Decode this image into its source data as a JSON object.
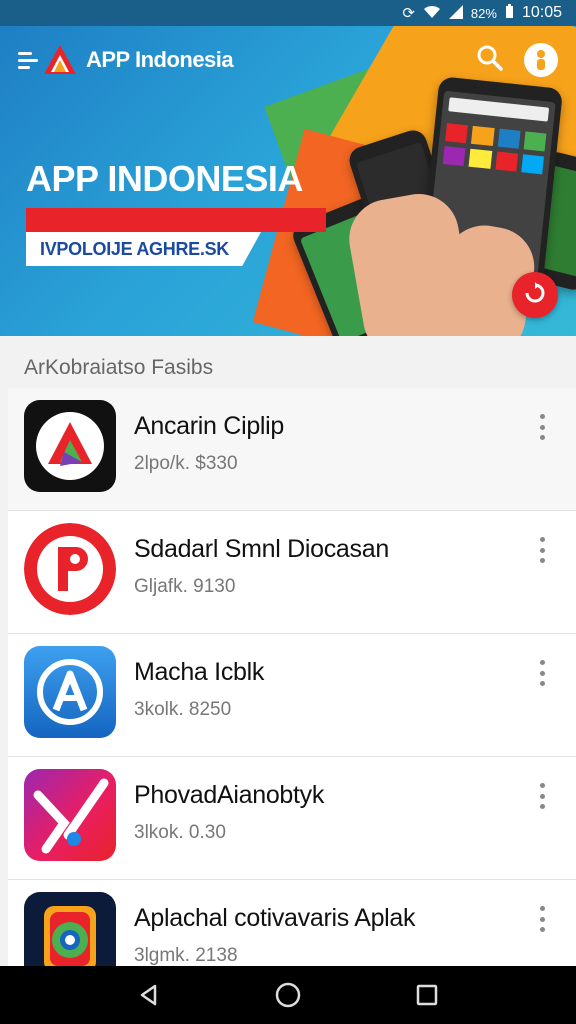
{
  "status_bar": {
    "battery": "82%",
    "time": "10:05",
    "icons": [
      "sync-icon",
      "wifi-icon",
      "signal-icon",
      "battery-icon"
    ]
  },
  "header": {
    "app_title": "APP Indonesia",
    "icons": [
      "menu-icon",
      "logo-icon",
      "search-icon",
      "avatar-icon"
    ]
  },
  "hero": {
    "title": "APP INDONESIA",
    "tagline": "IVPOLOIJE AGHRE.SK"
  },
  "section": {
    "title": "ArKobraiatso Fasibs"
  },
  "apps": [
    {
      "name": "Ancarin Ciplip",
      "meta": "2lpo/k. $330",
      "icon": "tri-logo-icon"
    },
    {
      "name": "Sdadarl Smnl Diocasan",
      "meta": "Gljafk. 9130",
      "icon": "p-logo-icon"
    },
    {
      "name": "Macha Icblk",
      "meta": "3kolk. 8250",
      "icon": "app-store-icon"
    },
    {
      "name": "PhovadAianobtyk",
      "meta": "3lkok. 0.30",
      "icon": "y-logo-icon"
    },
    {
      "name": "Aplachal cotivavaris Aplak",
      "meta": "3lgmk. 2138",
      "icon": "camera-logo-icon"
    }
  ],
  "colors": {
    "accent_red": "#e8232a",
    "hero_blue": "#1e7fc4",
    "orange": "#f7a21b",
    "green": "#4caf50"
  }
}
